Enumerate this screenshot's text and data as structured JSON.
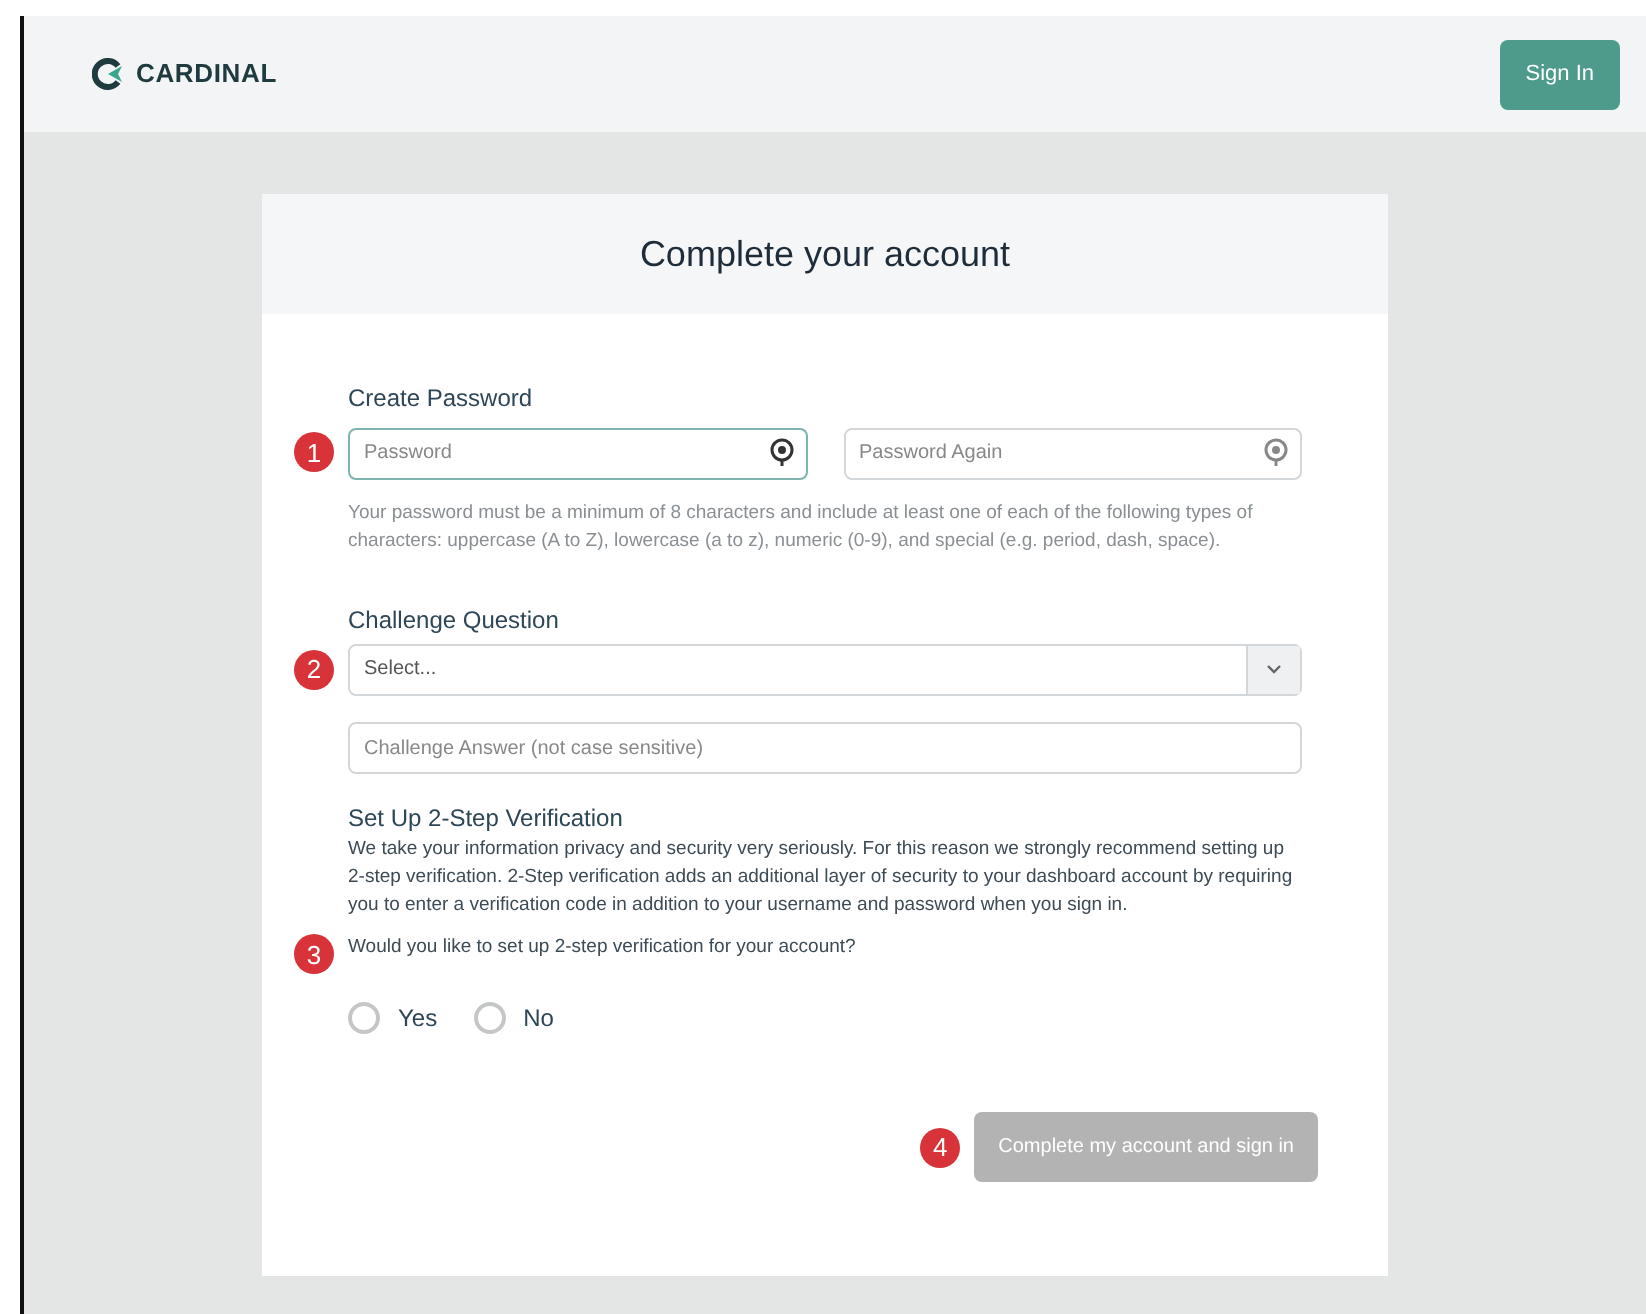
{
  "header": {
    "logo_text": "CARDINAL",
    "sign_in_button": "Sign In"
  },
  "card": {
    "title": "Complete your account",
    "password_section": {
      "badge": "1",
      "label": "Create Password",
      "fields": [
        {
          "placeholder": "Password",
          "focused": true
        },
        {
          "placeholder": "Password Again",
          "focused": false
        }
      ],
      "hint": "Your password must be a minimum of 8 characters and include at least one of each of the following types of characters: uppercase (A to Z), lowercase (a to z), numeric (0-9), and special (e.g. period, dash, space)."
    },
    "challenge_section": {
      "badge": "2",
      "label": "Challenge Question",
      "select_value": "Select...",
      "answer_placeholder": "Challenge Answer (not case sensitive)"
    },
    "verification_section": {
      "title": "Set Up 2-Step Verification",
      "description": "We take your information privacy and security very seriously. For this reason we strongly recommend setting up 2-step verification. 2-Step verification adds an additional layer of security to your dashboard account by requiring you to enter a verification code in addition to your username and password when you sign in.",
      "badge": "3",
      "question": "Would you like to set up 2-step verification for your account?",
      "options": [
        {
          "label": "Yes",
          "selected": false
        },
        {
          "label": "No",
          "selected": false
        }
      ]
    },
    "submit": {
      "badge": "4",
      "label": "Complete my account and sign in",
      "disabled": true
    }
  }
}
